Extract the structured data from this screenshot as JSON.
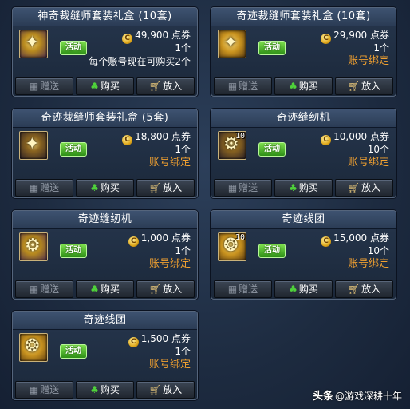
{
  "labels": {
    "event": "活动",
    "gift": "赠送",
    "buy": "购买",
    "cart": "放入",
    "currency": "点券"
  },
  "items": [
    {
      "title": "神奇裁缝师套装礼盒 (10套)",
      "price": "49,900",
      "qty": "1个",
      "note": "每个账号现在可购买2个"
    },
    {
      "title": "奇迹裁缝师套装礼盒 (10套)",
      "price": "29,900",
      "qty": "1个",
      "note": "账号绑定"
    },
    {
      "title": "奇迹裁缝师套装礼盒 (5套)",
      "price": "18,800",
      "qty": "1个",
      "note": "账号绑定"
    },
    {
      "title": "奇迹缝纫机",
      "price": "10,000",
      "qty": "10个",
      "note": "账号绑定",
      "stack": "10"
    },
    {
      "title": "奇迹缝纫机",
      "price": "1,000",
      "qty": "1个",
      "note": "账号绑定"
    },
    {
      "title": "奇迹线团",
      "price": "15,000",
      "qty": "10个",
      "note": "账号绑定",
      "stack": "10"
    },
    {
      "title": "奇迹线团",
      "price": "1,500",
      "qty": "1个",
      "note": "账号绑定"
    }
  ],
  "watermark": {
    "brand": "头条",
    "handle": "@游戏深耕十年"
  }
}
